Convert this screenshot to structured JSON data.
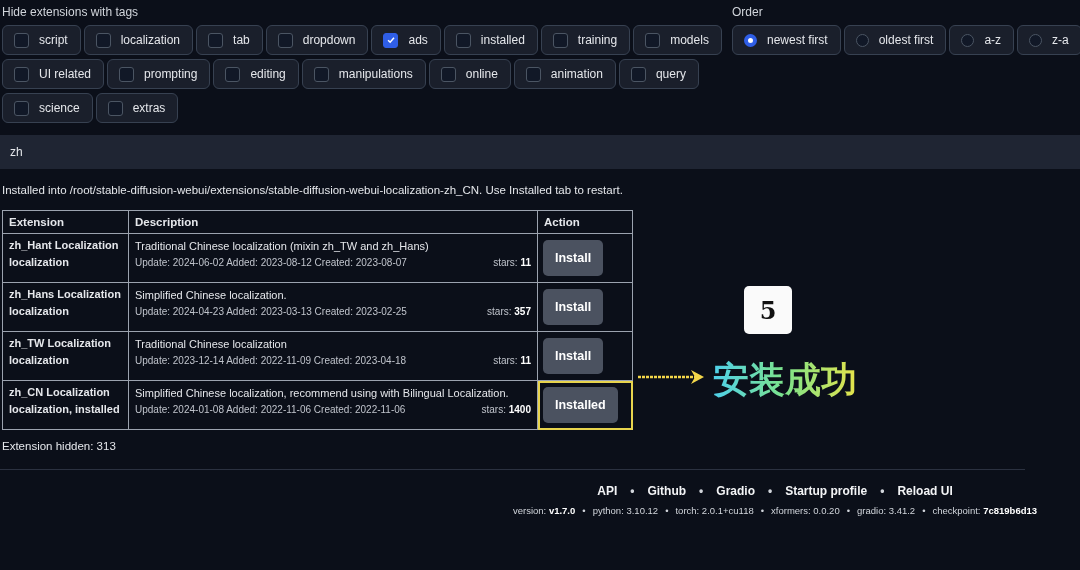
{
  "tag_filter": {
    "label": "Hide extensions with tags",
    "tags": [
      {
        "label": "script",
        "checked": false
      },
      {
        "label": "localization",
        "checked": false
      },
      {
        "label": "tab",
        "checked": false
      },
      {
        "label": "dropdown",
        "checked": false
      },
      {
        "label": "ads",
        "checked": true
      },
      {
        "label": "installed",
        "checked": false
      },
      {
        "label": "training",
        "checked": false
      },
      {
        "label": "models",
        "checked": false
      },
      {
        "label": "UI related",
        "checked": false
      },
      {
        "label": "prompting",
        "checked": false
      },
      {
        "label": "editing",
        "checked": false
      },
      {
        "label": "manipulations",
        "checked": false
      },
      {
        "label": "online",
        "checked": false
      },
      {
        "label": "animation",
        "checked": false
      },
      {
        "label": "query",
        "checked": false
      },
      {
        "label": "science",
        "checked": false
      },
      {
        "label": "extras",
        "checked": false
      }
    ]
  },
  "order": {
    "label": "Order",
    "options": [
      {
        "label": "newest first",
        "selected": true
      },
      {
        "label": "oldest first",
        "selected": false
      },
      {
        "label": "a-z",
        "selected": false
      },
      {
        "label": "z-a",
        "selected": false
      }
    ]
  },
  "search": {
    "value": "zh"
  },
  "message": "Installed into /root/stable-diffusion-webui/extensions/stable-diffusion-webui-localization-zh_CN. Use Installed tab to restart.",
  "table": {
    "columns": [
      "Extension",
      "Description",
      "Action"
    ],
    "rows": [
      {
        "name": "zh_Hant Localization",
        "tags": "localization",
        "description": "Traditional Chinese localization (mixin zh_TW and zh_Hans)",
        "dates": "Update: 2024-06-02 Added: 2023-08-12 Created: 2023-08-07",
        "stars": "stars: **11**",
        "action": "Install",
        "highlighted": false
      },
      {
        "name": "zh_Hans Localization",
        "tags": "localization",
        "description": "Simplified Chinese localization.",
        "dates": "Update: 2024-04-23 Added: 2023-03-13 Created: 2023-02-25",
        "stars": "stars: **357**",
        "action": "Install",
        "highlighted": false
      },
      {
        "name": "zh_TW Localization",
        "tags": "localization",
        "description": "Traditional Chinese localization",
        "dates": "Update: 2023-12-14 Added: 2022-11-09 Created: 2023-04-18",
        "stars": "stars: **11**",
        "action": "Install",
        "highlighted": false
      },
      {
        "name": "zh_CN Localization",
        "tags": "localization, installed",
        "description": "Simplified Chinese localization, recommend using with Bilingual Localization.",
        "dates": "Update: 2024-01-08 Added: 2022-11-06 Created: 2022-11-06",
        "stars": "stars: **1400**",
        "action": "Installed",
        "highlighted": true
      }
    ]
  },
  "hidden_count": "Extension hidden: 313",
  "annotation": {
    "step": "5",
    "caption": "安装成功"
  },
  "footer": {
    "separator": "•",
    "links": [
      "API",
      "Github",
      "Gradio",
      "Startup profile",
      "Reload UI"
    ],
    "versions": [
      "version: **v1.7.0**",
      "python: 3.10.12",
      "torch: 2.0.1+cu118",
      "xformers: 0.0.20",
      "gradio: 3.41.2",
      "checkpoint: **7c819b6d13**"
    ]
  }
}
